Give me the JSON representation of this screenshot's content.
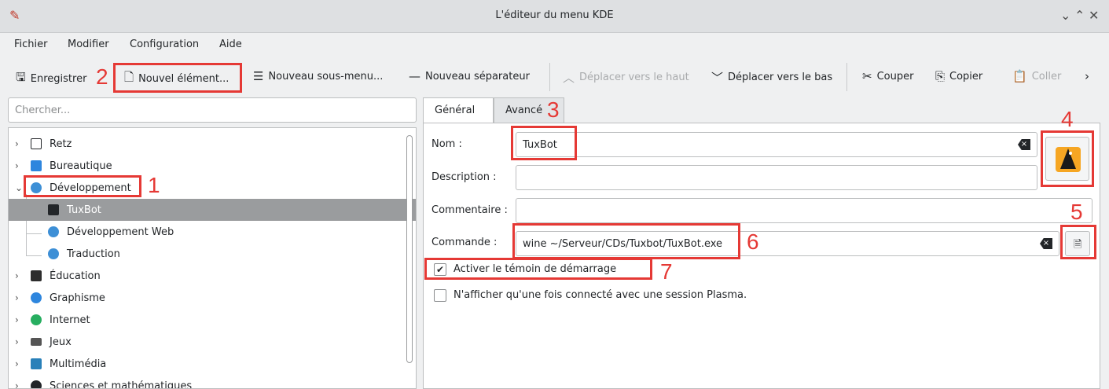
{
  "window": {
    "title": "L'éditeur du menu KDE"
  },
  "menubar": [
    "Fichier",
    "Modifier",
    "Configuration",
    "Aide"
  ],
  "toolbar": {
    "save": "Enregistrer",
    "new_item": "Nouvel élément...",
    "new_submenu": "Nouveau sous-menu...",
    "new_separator": "Nouveau séparateur",
    "move_up": "Déplacer vers le haut",
    "move_down": "Déplacer vers le bas",
    "cut": "Couper",
    "copy": "Copier",
    "paste": "Coller"
  },
  "search": {
    "placeholder": "Chercher..."
  },
  "tree": {
    "items": [
      {
        "label": "Retz",
        "icon": "folder-icon",
        "color": "#232629"
      },
      {
        "label": "Bureautique",
        "icon": "office-icon",
        "color": "#2e86de"
      },
      {
        "label": "Développement",
        "icon": "development-icon",
        "color": "#3d8fd6"
      },
      {
        "label": "TuxBot",
        "icon": "tux-icon",
        "color": "#232629"
      },
      {
        "label": "Développement Web",
        "icon": "web-dev-icon",
        "color": "#3d8fd6"
      },
      {
        "label": "Traduction",
        "icon": "translation-icon",
        "color": "#3d8fd6"
      },
      {
        "label": "Éducation",
        "icon": "education-icon",
        "color": "#2d2d2d"
      },
      {
        "label": "Graphisme",
        "icon": "graphics-icon",
        "color": "#2e86de"
      },
      {
        "label": "Internet",
        "icon": "internet-icon",
        "color": "#27ae60"
      },
      {
        "label": "Jeux",
        "icon": "games-icon",
        "color": "#555555"
      },
      {
        "label": "Multimédia",
        "icon": "multimedia-icon",
        "color": "#2980b9"
      },
      {
        "label": "Sciences et mathématiques",
        "icon": "science-icon",
        "color": "#232629"
      }
    ]
  },
  "tabs": {
    "general": "Général",
    "advanced": "Avancé"
  },
  "form": {
    "name_label": "Nom :",
    "name_value": "TuxBot",
    "description_label": "Description :",
    "description_value": "",
    "comment_label": "Commentaire :",
    "comment_value": "",
    "command_label": "Commande :",
    "command_value": "wine ~/Serveur/CDs/Tuxbot/TuxBot.exe",
    "startup_feedback": "Activer le témoin de démarrage",
    "plasma_only": "N'afficher qu'une fois connecté avec une session Plasma."
  },
  "annotations": [
    "1",
    "2",
    "3",
    "4",
    "5",
    "6",
    "7"
  ],
  "colors": {
    "annotation": "#e53935",
    "selection": "#9a9c9e"
  }
}
